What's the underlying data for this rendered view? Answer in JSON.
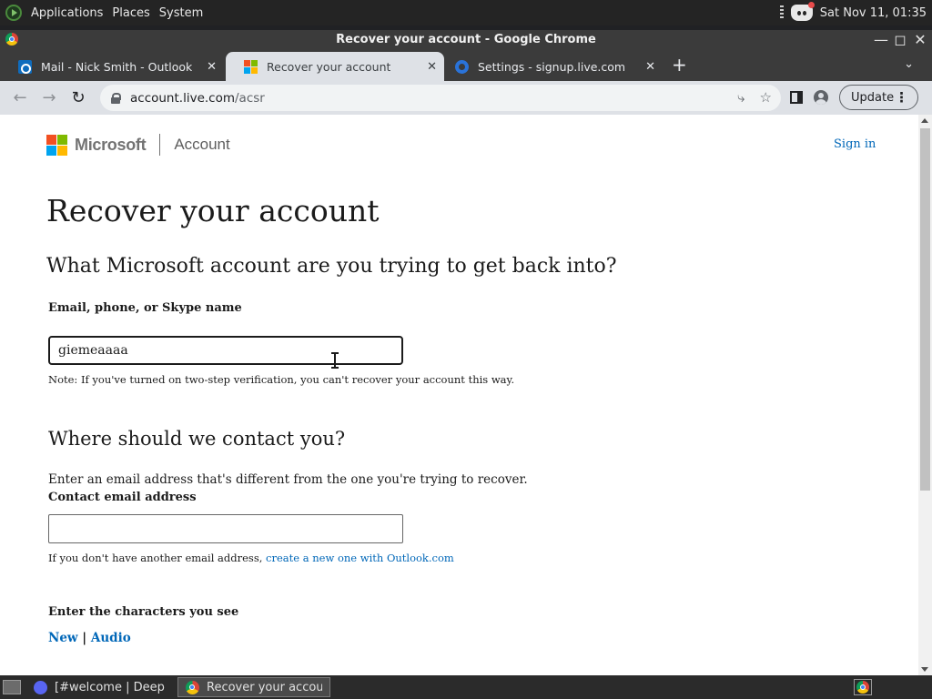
{
  "desktop": {
    "menu": [
      "Applications",
      "Places",
      "System"
    ],
    "clock": "Sat Nov 11, 01:35"
  },
  "window": {
    "title": "Recover your account - Google Chrome"
  },
  "tabs": [
    {
      "label": "Mail - Nick Smith - Outlook",
      "icon": "outlook-icon",
      "active": false
    },
    {
      "label": "Recover your account",
      "icon": "microsoft-icon",
      "active": true
    },
    {
      "label": "Settings - signup.live.com",
      "icon": "gear-icon",
      "active": false
    }
  ],
  "toolbar": {
    "url_host": "account.live.com",
    "url_path": "/acsr",
    "update_label": "Update"
  },
  "page": {
    "brand": "Microsoft",
    "section": "Account",
    "sign_in": "Sign in",
    "heading": "Recover your account",
    "question": "What Microsoft account are you trying to get back into?",
    "email_label": "Email, phone, or Skype name",
    "email_value": "giemeaaaa",
    "note": "Note: If you've turned on two-step verification, you can't recover your account this way.",
    "contact_heading": "Where should we contact you?",
    "contact_help": "Enter an email address that's different from the one you're trying to recover.",
    "contact_label": "Contact email address",
    "contact_value": "",
    "alt_note_prefix": "If you don't have another email address, ",
    "alt_note_link": "create a new one with Outlook.com",
    "captcha_label": "Enter the characters you see",
    "captcha_new": "New",
    "captcha_sep": " | ",
    "captcha_audio": "Audio"
  },
  "taskbar": {
    "tasks": [
      {
        "label": "[#welcome | Deep R...",
        "icon": "discord-icon",
        "active": false
      },
      {
        "label": "Recover your accoun...",
        "icon": "chrome-icon",
        "active": true
      }
    ]
  },
  "colors": {
    "link": "#0067b8",
    "ms_red": "#f25022",
    "ms_green": "#7fba00",
    "ms_blue": "#00a4ef",
    "ms_yellow": "#ffb900"
  }
}
